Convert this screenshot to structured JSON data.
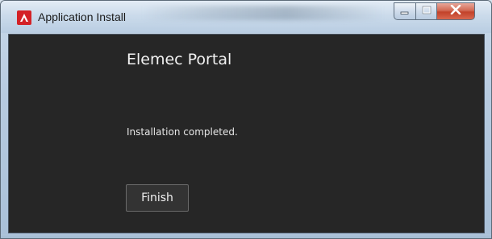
{
  "window": {
    "title": "Application Install",
    "icon": "adobe-air-icon",
    "controls": {
      "minimize": "minimize-icon",
      "maximize": "maximize-icon",
      "close": "close-icon"
    }
  },
  "content": {
    "app_name": "Elemec Portal",
    "status": "Installation completed.",
    "finish_label": "Finish"
  },
  "colors": {
    "background": "#262626",
    "text": "#f2f2f2",
    "close_button": "#c2422a",
    "app_icon": "#d42126"
  }
}
